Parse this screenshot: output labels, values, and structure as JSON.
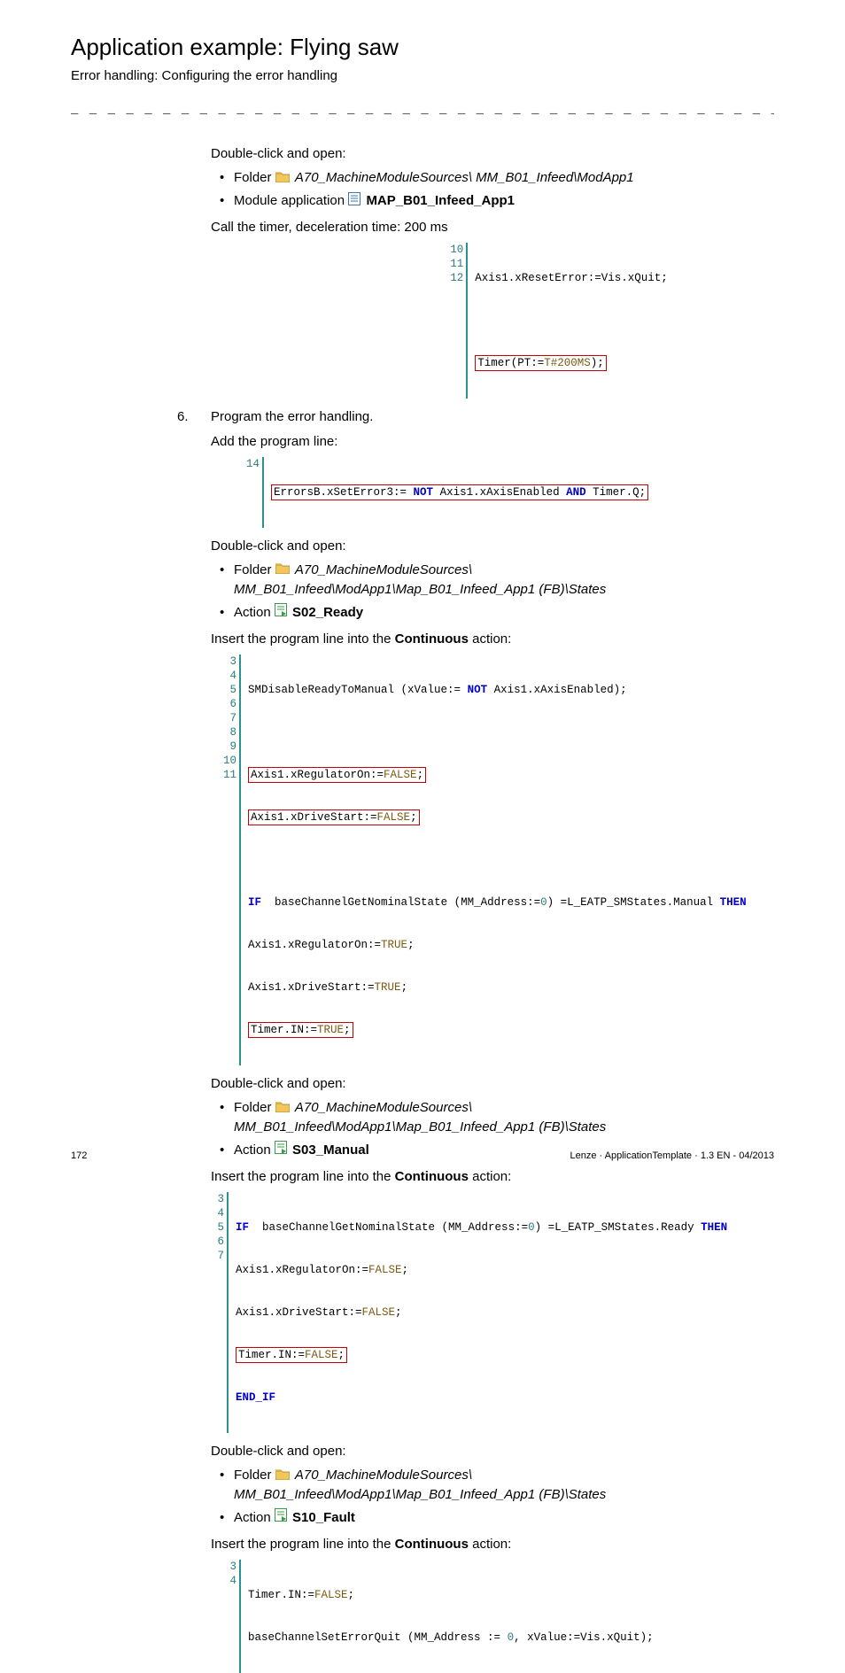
{
  "header": {
    "title": "Application example: Flying saw",
    "subtitle": "Error handling: Configuring the error handling"
  },
  "dashes": "_ _ _ _ _ _ _ _ _ _ _ _ _ _ _ _ _ _ _ _ _ _ _ _ _ _ _ _ _ _ _ _ _ _ _ _ _ _ _ _ _ _ _ _ _ _ _ _ _ _ _ _ _ _ _ _ _ _ _ _ _ _ _ _",
  "t": {
    "dco": "Double-click and open:",
    "folder": "Folder",
    "module_app": "Module application",
    "action": "Action",
    "call_timer": "Call the timer, deceleration time: 200 ms",
    "prog_err": "Program the error handling.",
    "add_line": "Add the program line:",
    "insert_pre": "Insert the program line into the ",
    "continuous": "Continuous",
    "insert_post": " action:"
  },
  "paths": {
    "p1": "A70_MachineModuleSources\\ MM_B01_Infeed\\ModApp1",
    "mod1": "MAP_B01_Infeed_App1",
    "p2a": "A70_MachineModuleSources\\",
    "p2b": "MM_B01_Infeed\\ModApp1\\Map_B01_Infeed_App1 (FB)\\States",
    "s02": "S02_Ready",
    "s03": "S03_Manual",
    "s10": "S10_Fault"
  },
  "step6": "6.",
  "code1": {
    "g": [
      "10",
      "11",
      "12"
    ],
    "l10a": "Axis1.xResetError:=Vis.xQuit;",
    "l12a": "Timer(PT:=",
    "l12b": "T#200MS",
    "l12c": ");"
  },
  "code2": {
    "g": [
      "14"
    ],
    "l14a": "ErrorsB.xSetError3:= ",
    "l14c": " Axis1.xAxisEnabled ",
    "l14e": " Timer.Q;"
  },
  "code3": {
    "g": [
      "3",
      "4",
      "5",
      "6",
      "7",
      "8",
      "9",
      "10",
      "11"
    ],
    "l3a": "SMDisableReadyToManual (xValue:= ",
    "l3b": " Axis1.xAxisEnabled);",
    "l5a": "Axis1.xRegulatorOn:=",
    "l6a": "Axis1.xDriveStart:=",
    "l8a": "  baseChannelGetNominalState (MM_Address:=",
    "l8b": ") =L_EATP_SMStates.Manual ",
    "l9a": "Axis1.xRegulatorOn:=",
    "l10a": "Axis1.xDriveStart:=",
    "l11a": "Timer.IN:="
  },
  "code4": {
    "g": [
      "3",
      "4",
      "5",
      "6",
      "7"
    ],
    "l3a": "  baseChannelGetNominalState (MM_Address:=",
    "l3b": ") =L_EATP_SMStates.Ready ",
    "l4a": "Axis1.xRegulatorOn:=",
    "l5a": "Axis1.xDriveStart:=",
    "l6a": "Timer.IN:="
  },
  "code5": {
    "g": [
      "3",
      "4"
    ],
    "l3a": "Timer.IN:=",
    "l4a": "baseChannelSetErrorQuit (MM_Address := ",
    "l4b": ", xValue:=Vis.xQuit);"
  },
  "kw": {
    "NOT": "NOT",
    "AND": "AND",
    "IF": "IF",
    "THEN": "THEN",
    "END_IF": "END_IF"
  },
  "val": {
    "FALSE": "FALSE",
    "TRUE": "TRUE",
    "semi": ";",
    "zero": "0"
  },
  "footer": {
    "page": "172",
    "meta": "Lenze · ApplicationTemplate · 1.3 EN - 04/2013"
  }
}
